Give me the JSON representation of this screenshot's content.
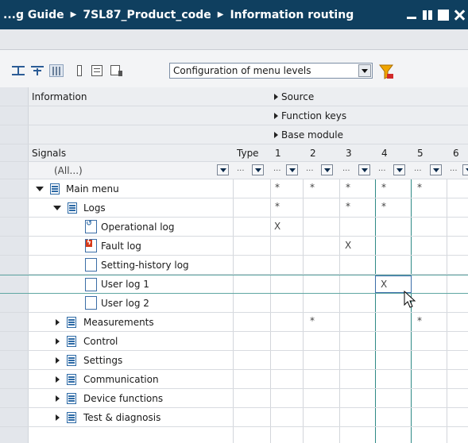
{
  "window": {
    "breadcrumb": [
      "...g Guide",
      "7SL87_Product_code",
      "Information routing"
    ]
  },
  "toolbar": {
    "config_select_value": "Configuration of menu levels"
  },
  "header": {
    "information_label": "Information",
    "source_label": "Source",
    "function_keys_label": "Function keys",
    "base_module_label": "Base module",
    "signals_label": "Signals",
    "type_label": "Type",
    "columns": [
      "1",
      "2",
      "3",
      "4",
      "5",
      "6"
    ],
    "filter_all": "(All...)"
  },
  "rows": [
    {
      "label": "Main menu",
      "marks": [
        "*",
        "*",
        "*",
        "*",
        "*",
        ""
      ]
    },
    {
      "label": "Logs",
      "marks": [
        "*",
        "",
        "*",
        "*",
        "",
        ""
      ]
    },
    {
      "label": "Operational log",
      "marks": [
        "X",
        "",
        "",
        "",
        "",
        ""
      ]
    },
    {
      "label": "Fault log",
      "marks": [
        "",
        "",
        "X",
        "",
        "",
        ""
      ]
    },
    {
      "label": "Setting-history log",
      "marks": [
        "",
        "",
        "",
        "",
        "",
        ""
      ]
    },
    {
      "label": "User log 1",
      "marks": [
        "",
        "",
        "",
        "X",
        "",
        ""
      ]
    },
    {
      "label": "User log 2",
      "marks": [
        "",
        "",
        "",
        "",
        "",
        ""
      ]
    },
    {
      "label": "Measurements",
      "marks": [
        "",
        "*",
        "",
        "",
        "*",
        ""
      ]
    },
    {
      "label": "Control",
      "marks": [
        "",
        "",
        "",
        "",
        "",
        ""
      ]
    },
    {
      "label": "Settings",
      "marks": [
        "",
        "",
        "",
        "",
        "",
        ""
      ]
    },
    {
      "label": "Communication",
      "marks": [
        "",
        "",
        "",
        "",
        "",
        ""
      ]
    },
    {
      "label": "Device functions",
      "marks": [
        "",
        "",
        "",
        "",
        "",
        ""
      ]
    },
    {
      "label": "Test & diagnosis",
      "marks": [
        "",
        "",
        "",
        "",
        "",
        ""
      ]
    }
  ],
  "colors": {
    "titlebar": "#0f3f5f",
    "accent_blue": "#2d6aa6",
    "teal_gridline": "#2f8a86"
  },
  "icons": {
    "main_menu": "menu-icon",
    "operational_log": "operational-log-icon",
    "fault_log": "fault-log-icon",
    "setting_history_log": "log-icon",
    "user_log": "log-icon",
    "filter": "filter-icon"
  }
}
